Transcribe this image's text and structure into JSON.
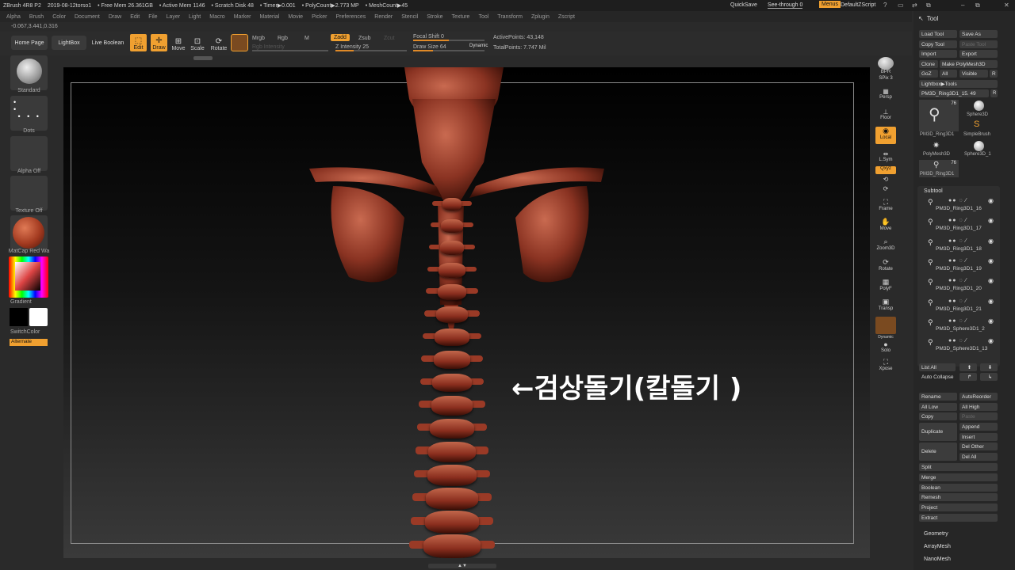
{
  "titlebar": {
    "app": "ZBrush 4R8 P2",
    "file": "2019-08-12torso1",
    "free_mem": "• Free Mem 26.361GB",
    "active_mem": "• Active Mem 1146",
    "scratch": "• Scratch Disk 48",
    "timer": "• Timer▶0.001",
    "polycount": "• PolyCount▶2.773 MP",
    "meshcount": "• MeshCount▶45",
    "quicksave": "QuickSave",
    "seethrough": "See-through  0",
    "menus": "Menus",
    "script": "DefaultZScript"
  },
  "menubar": [
    "Alpha",
    "Brush",
    "Color",
    "Document",
    "Draw",
    "Edit",
    "File",
    "Layer",
    "Light",
    "Macro",
    "Marker",
    "Material",
    "Movie",
    "Picker",
    "Preferences",
    "Render",
    "Stencil",
    "Stroke",
    "Texture",
    "Tool",
    "Transform",
    "Zplugin",
    "Zscript"
  ],
  "coords": "-0.067,3.441,0.316",
  "topbar": {
    "home": "Home Page",
    "lightbox": "LightBox",
    "liveboolean": "Live Boolean",
    "edit": "Edit",
    "draw": "Draw",
    "move": "Move",
    "scale": "Scale",
    "rotate": "Rotate",
    "mrgb": "Mrgb",
    "rgb": "Rgb",
    "m": "M",
    "rgb_intensity": "Rgb Intensity",
    "zadd": "Zadd",
    "zsub": "Zsub",
    "zcut": "Zcut",
    "z_intensity": "Z Intensity 25",
    "focal_shift": "Focal Shift 0",
    "draw_size": "Draw Size 64",
    "dynamic": "Dynamic",
    "active_points": "ActivePoints: 43,148",
    "total_points": "TotalPoints: 7.747 Mil"
  },
  "leftshelf": {
    "standard": "Standard",
    "dots": "Dots",
    "alpha_off": "Alpha Off",
    "texture_off": "Texture Off",
    "matcap": "MatCap Red Wa",
    "gradient": "Gradient",
    "switchcolor": "SwitchColor",
    "alternate": "Alternate"
  },
  "annotation": "←검상돌기(칼돌기 )",
  "rightshelf": {
    "bpr": "BPR",
    "spix": "SPix 3",
    "persp": "Persp",
    "floor": "Floor",
    "local": "Local",
    "lsym": "L.Sym",
    "xyz": "Qxyz",
    "frame": "Frame",
    "move": "Move",
    "zoom3d": "Zoom3D",
    "rotate": "Rotate",
    "polyf": "PolyF",
    "transp": "Transp",
    "dynamic": "Dynamic",
    "solo": "Solo",
    "xpose": "Xpose"
  },
  "tool": {
    "header": "Tool",
    "load": "Load Tool",
    "saveas": "Save As",
    "copy": "Copy Tool",
    "paste": "Paste Tool",
    "import": "Import",
    "export": "Export",
    "clone": "Clone",
    "makepoly": "Make PolyMesh3D",
    "goz": "GoZ",
    "all": "All",
    "visible": "Visible",
    "r": "R",
    "lightbox_tools": "Lightbox▶Tools",
    "current": "PM3D_Ring3D1_15. 49",
    "thumbs": [
      {
        "label": "PM3D_Ring3D1",
        "badge": "76"
      },
      {
        "label": "Sphere3D",
        "badge": ""
      },
      {
        "label": "SimpleBrush",
        "badge": ""
      },
      {
        "label": "PolyMesh3D",
        "badge": ""
      },
      {
        "label": "Sphere3D_1",
        "badge": ""
      },
      {
        "label": "PM3D_Ring3D1",
        "badge": "76"
      }
    ]
  },
  "subtool": {
    "header": "Subtool",
    "items": [
      "PM3D_Ring3D1_16",
      "PM3D_Ring3D1_17",
      "PM3D_Ring3D1_18",
      "PM3D_Ring3D1_19",
      "PM3D_Ring3D1_20",
      "PM3D_Ring3D1_21",
      "PM3D_Sphere3D1_2",
      "PM3D_Sphere3D1_13"
    ],
    "list_all": "List All",
    "auto_collapse": "Auto Collapse",
    "rename": "Rename",
    "autoreorder": "AutoReorder",
    "all_low": "All Low",
    "all_high": "All High",
    "copy": "Copy",
    "paste": "Paste",
    "duplicate": "Duplicate",
    "append": "Append",
    "insert": "Insert",
    "delete": "Delete",
    "del_other": "Del Other",
    "del_all": "Del All",
    "split": "Split",
    "merge": "Merge",
    "boolean": "Boolean",
    "remesh": "Remesh",
    "project": "Project",
    "extract": "Extract"
  },
  "bottom_sections": [
    "Geometry",
    "ArrayMesh",
    "NanoMesh"
  ]
}
